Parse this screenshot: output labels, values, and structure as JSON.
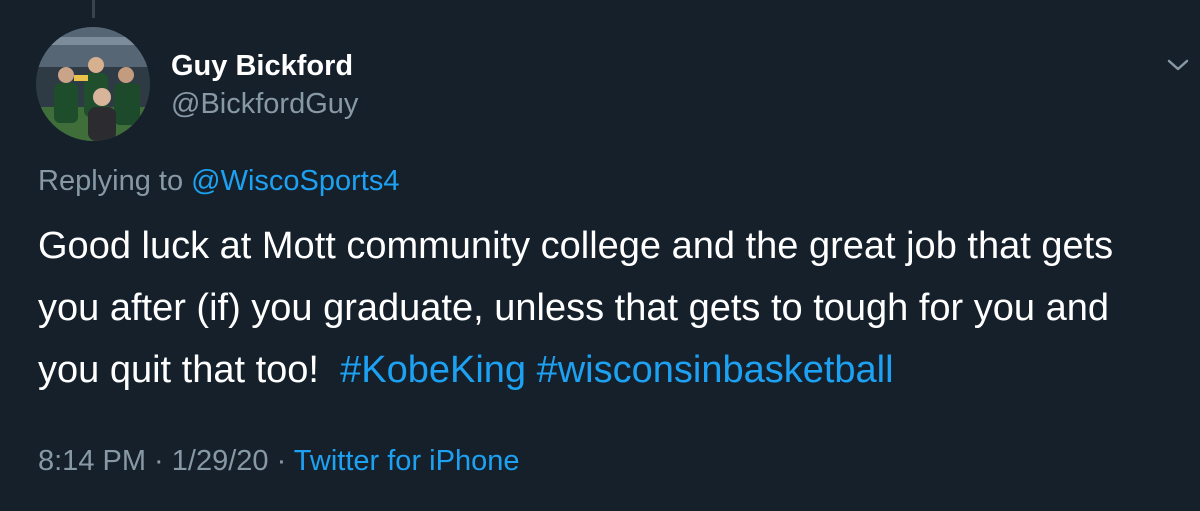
{
  "colors": {
    "background": "#15202b",
    "primary_text": "#ffffff",
    "secondary_text": "#8899a6",
    "link": "#1da1f2"
  },
  "author": {
    "display_name": "Guy Bickford",
    "handle": "@BickfordGuy",
    "avatar_icon": "profile-photo"
  },
  "reply": {
    "prefix": "Replying to ",
    "target": "@WiscoSports4"
  },
  "tweet": {
    "text": "Good luck at Mott community college and the great job that gets you after (if) you graduate, unless that gets to tough for you and you quit that too!  ",
    "hashtags": [
      "#KobeKing",
      "#wisconsinbasketball"
    ],
    "hashtag_separator": " "
  },
  "meta": {
    "time": "8:14 PM",
    "separator": " · ",
    "date": "1/29/20",
    "source": "Twitter for iPhone"
  },
  "menu": {
    "icon": "chevron-down-icon"
  }
}
